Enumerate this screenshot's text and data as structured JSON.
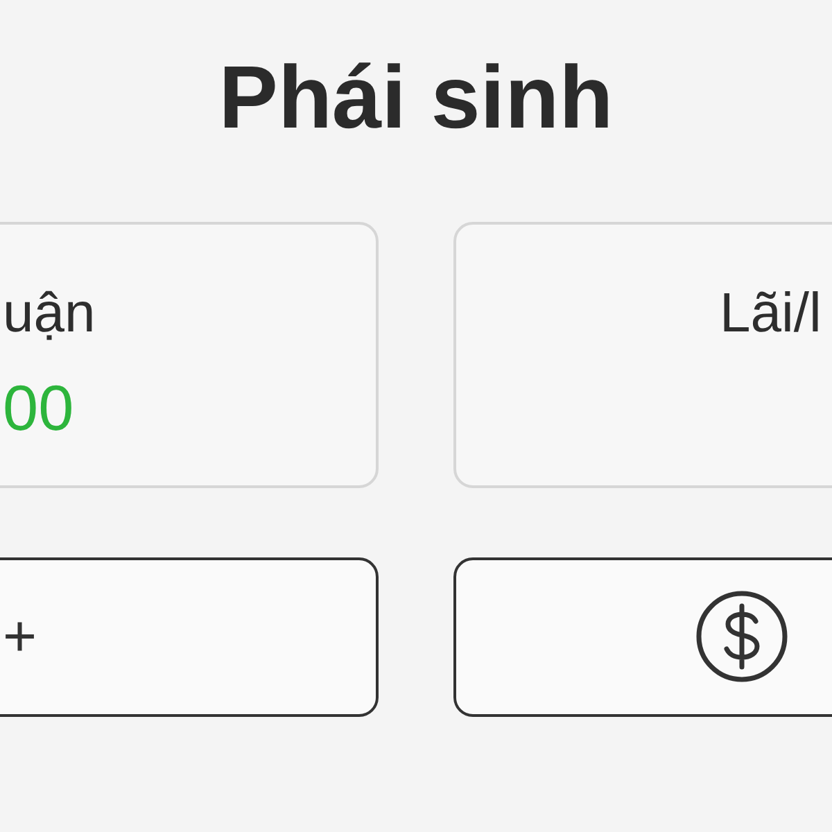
{
  "title": "Phái sinh",
  "cards": [
    {
      "label": "uận",
      "value": "00"
    },
    {
      "label": "Lãi/l"
    }
  ],
  "buttons": [
    {
      "kind": "text",
      "label": "+"
    },
    {
      "kind": "icon"
    }
  ]
}
